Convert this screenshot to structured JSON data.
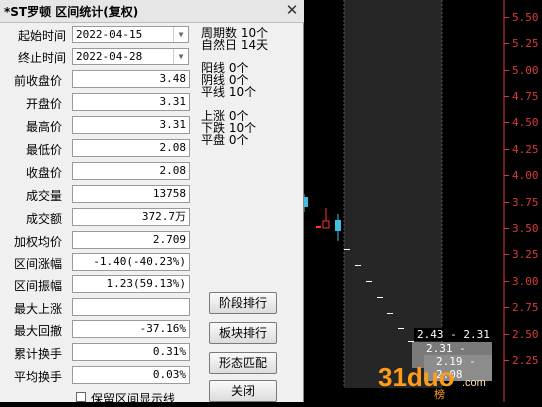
{
  "dialog": {
    "title": "*ST罗顿 区间统计(复权)",
    "start_label": "起始时间",
    "start_date": "2022-04-15",
    "end_label": "终止时间",
    "end_date": "2022-04-28",
    "fields": [
      {
        "label": "前收盘价",
        "value": "3.48"
      },
      {
        "label": "开盘价",
        "value": "3.31"
      },
      {
        "label": "最高价",
        "value": "3.31"
      },
      {
        "label": "最低价",
        "value": "2.08"
      },
      {
        "label": "收盘价",
        "value": "2.08"
      },
      {
        "label": "成交量",
        "value": "13758"
      },
      {
        "label": "成交额",
        "value": "372.7万"
      },
      {
        "label": "加权均价",
        "value": "2.709"
      },
      {
        "label": "区间涨幅",
        "value": "-1.40(-40.23%)"
      },
      {
        "label": "区间振幅",
        "value": "1.23(59.13%)"
      },
      {
        "label": "最大上涨",
        "value": ""
      },
      {
        "label": "最大回撤",
        "value": "-37.16%"
      },
      {
        "label": "累计换手",
        "value": "0.31%"
      },
      {
        "label": "平均换手",
        "value": "0.03%"
      }
    ],
    "stats": [
      {
        "label": "周期数",
        "value": "10个"
      },
      {
        "label": "自然日",
        "value": "14天"
      },
      {
        "label": "阳线",
        "value": "0个"
      },
      {
        "label": "阴线",
        "value": "0个"
      },
      {
        "label": "平线",
        "value": "10个"
      },
      {
        "label": "上涨",
        "value": "0个"
      },
      {
        "label": "下跌",
        "value": "10个"
      },
      {
        "label": "平盘",
        "value": "0个"
      }
    ],
    "buttons": {
      "stage_rank": "阶段排行",
      "sector_rank": "板块排行",
      "pattern_match": "形态匹配",
      "close": "关闭"
    },
    "checkbox_label": "保留区间显示线"
  },
  "chart": {
    "axis_labels": [
      "5.50",
      "5.25",
      "5.00",
      "4.75",
      "4.50",
      "4.25",
      "4.00",
      "3.75",
      "3.50",
      "3.25",
      "3.00",
      "2.75",
      "2.50",
      "2.25"
    ],
    "range_labels": [
      "2.43 - 2.31",
      "2.31 - 2.19",
      "2.19 - 2.08"
    ],
    "corner_glyph": "榜",
    "up_color": "#ff3333",
    "down_color": "#40c0e0",
    "axis_color": "#d83a3a"
  },
  "watermark": {
    "main": "31duo",
    "suffix": ".com"
  }
}
